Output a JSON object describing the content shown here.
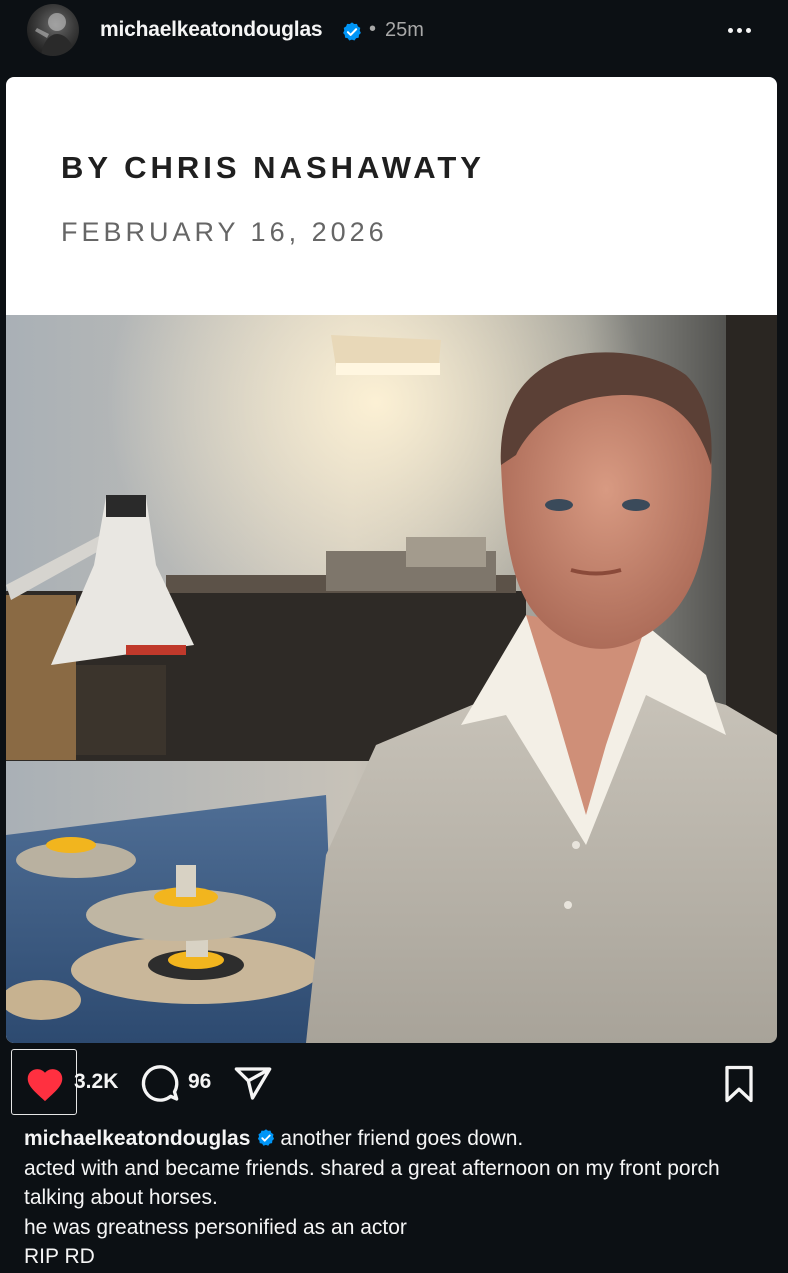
{
  "post": {
    "username": "michaelkeatondouglas",
    "time_separator": "•",
    "time_ago": "25m",
    "more_icon": "more-horizontal-icon"
  },
  "card": {
    "byline": "BY CHRIS NASHAWATY",
    "date": "FEBRUARY 16, 2026"
  },
  "actions": {
    "likes": "3.2K",
    "liked": true,
    "comments": "96",
    "like_icon": "heart-filled-icon",
    "comment_icon": "comment-icon",
    "share_icon": "send-icon",
    "save_icon": "bookmark-icon"
  },
  "caption": {
    "username": "michaelkeatondouglas",
    "first_line": "another friend goes down.",
    "lines": [
      "acted with and became friends. shared a great afternoon on my front porch talking about horses.",
      "he was greatness personified as an actor",
      "RIP RD"
    ]
  },
  "colors": {
    "background": "#0c1014",
    "verified": "#0095f6",
    "like": "#ff3040",
    "secondary_text": "#a8a8a8"
  }
}
